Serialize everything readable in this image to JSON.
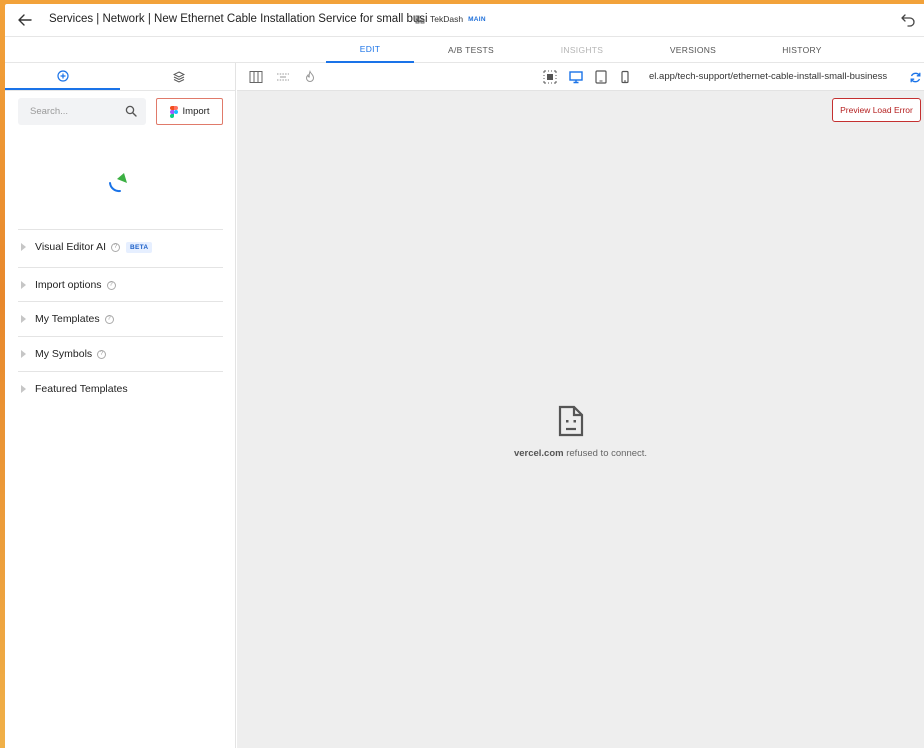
{
  "header": {
    "title": "Services | Network | New Ethernet Cable Installation Service for small busi",
    "model_name": "TekDash",
    "model_badge": "MAIN"
  },
  "top_tabs": [
    {
      "label": "EDIT",
      "state": "active"
    },
    {
      "label": "A/B TESTS",
      "state": "normal"
    },
    {
      "label": "INSIGHTS",
      "state": "disabled"
    },
    {
      "label": "VERSIONS",
      "state": "normal"
    },
    {
      "label": "HISTORY",
      "state": "normal"
    }
  ],
  "left_panel": {
    "tabs": [
      {
        "icon": "add-circle-icon",
        "active": true
      },
      {
        "icon": "layers-icon",
        "active": false
      }
    ],
    "search": {
      "placeholder": "Search...",
      "value": ""
    },
    "import_label": "Import",
    "sections": [
      {
        "label": "Visual Editor AI",
        "help": true,
        "badge": "BETA"
      },
      {
        "label": "Import options",
        "help": true
      },
      {
        "label": "My Templates",
        "help": true
      },
      {
        "label": "My Symbols",
        "help": true
      },
      {
        "label": "Featured Templates",
        "help": false
      }
    ]
  },
  "toolbar": {
    "url": "el.app/tech-support/ethernet-cable-install-small-business",
    "active_device": "desktop"
  },
  "canvas": {
    "error_button": "Preview Load Error",
    "refused_host": "vercel.com",
    "refused_text": " refused to connect."
  },
  "colors": {
    "accent": "#1a73e8",
    "error": "#c43030",
    "canvas_bg": "#eeeeee",
    "spinner_green": "#3cb043"
  }
}
